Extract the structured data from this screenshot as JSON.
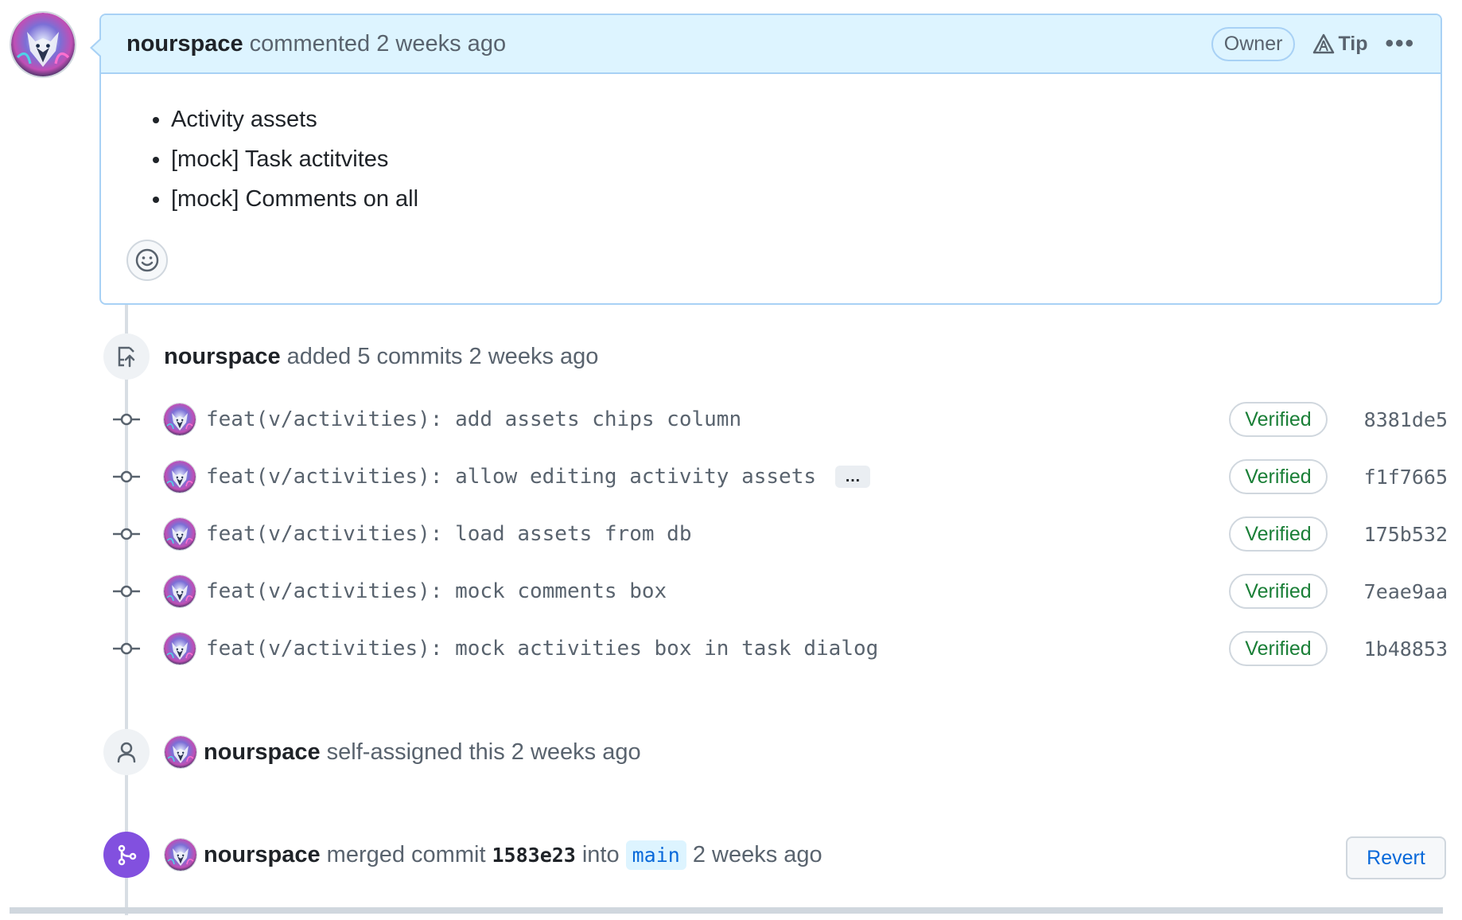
{
  "comment": {
    "author": "nourspace",
    "action": "commented 2 weeks ago",
    "badge": "Owner",
    "tip_label": "Tip",
    "menu_label": "•••",
    "items": [
      "Activity assets",
      "[mock] Task actitvites",
      "[mock] Comments on all"
    ]
  },
  "commits_event": {
    "author": "nourspace",
    "text": "added 5 commits 2 weeks ago",
    "commits": [
      {
        "message": "feat(v/activities): add assets chips column",
        "status": "Verified",
        "sha": "8381de5"
      },
      {
        "message": "feat(v/activities): allow editing activity assets",
        "status": "Verified",
        "sha": "f1f7665",
        "more": "…"
      },
      {
        "message": "feat(v/activities): load assets from db",
        "status": "Verified",
        "sha": "175b532"
      },
      {
        "message": "feat(v/activities): mock comments box",
        "status": "Verified",
        "sha": "7eae9aa"
      },
      {
        "message": "feat(v/activities): mock activities box in task dialog",
        "status": "Verified",
        "sha": "1b48853"
      }
    ]
  },
  "assign_event": {
    "author": "nourspace",
    "text": "self-assigned this 2 weeks ago"
  },
  "merge_event": {
    "author": "nourspace",
    "merged_text": "merged commit",
    "sha": "1583e23",
    "into": "into",
    "branch": "main",
    "time": "2 weeks ago",
    "revert_label": "Revert"
  },
  "colors": {
    "accent_blue": "#0969da",
    "verified_green": "#1a7f37",
    "merge_purple": "#8250df",
    "header_bg": "#ddf4ff"
  }
}
